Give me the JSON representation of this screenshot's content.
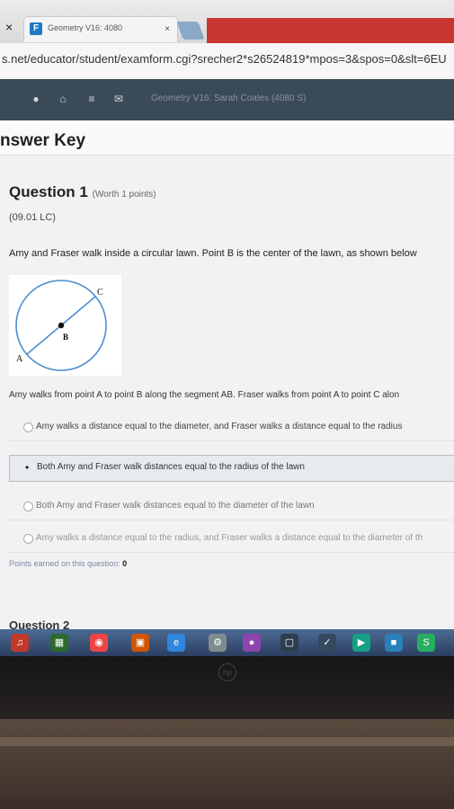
{
  "browser": {
    "tab_close": "×",
    "tab_title": "Geometry V16: 4080",
    "tab_x": "×",
    "url": "s.net/educator/student/examform.cgi?srecher2*s26524819*mpos=3&spos=0&slt=6EU"
  },
  "site": {
    "title": "Geometry V16: Sarah Coates (4080 S)"
  },
  "page": {
    "answer_key": "nswer Key",
    "question_label": "Question 1",
    "worth": "(Worth 1 points)",
    "code": "(09.01 LC)",
    "prompt": "Amy and Fraser walk inside a circular lawn. Point B is the center of the lawn, as shown below",
    "figure_labels": {
      "c": "C",
      "b": "B",
      "a": "A"
    },
    "prompt2": "Amy walks from point A to point B along the segment AB. Fraser walks from point A to point C alon",
    "options": [
      "Amy walks a distance equal to the diameter, and Fraser walks a distance equal to the radius",
      "Both Amy and Fraser walk distances equal to the radius of the lawn",
      "Both Amy and Fraser walk distances equal to the diameter of the lawn",
      "Amy walks a distance equal to the radius, and Fraser walks a distance equal to the diameter of th"
    ],
    "selected_bullet": "•",
    "points_label": "Points earned on this question:",
    "points_value": "0",
    "next_question": "Question 2"
  },
  "colors": {
    "tab_red": "#c7362f",
    "site_bar": "#3b4a57",
    "taskbar": "#3c5578"
  },
  "icons": [
    "home-icon",
    "menu-icon",
    "mail-icon",
    "search-icon"
  ]
}
